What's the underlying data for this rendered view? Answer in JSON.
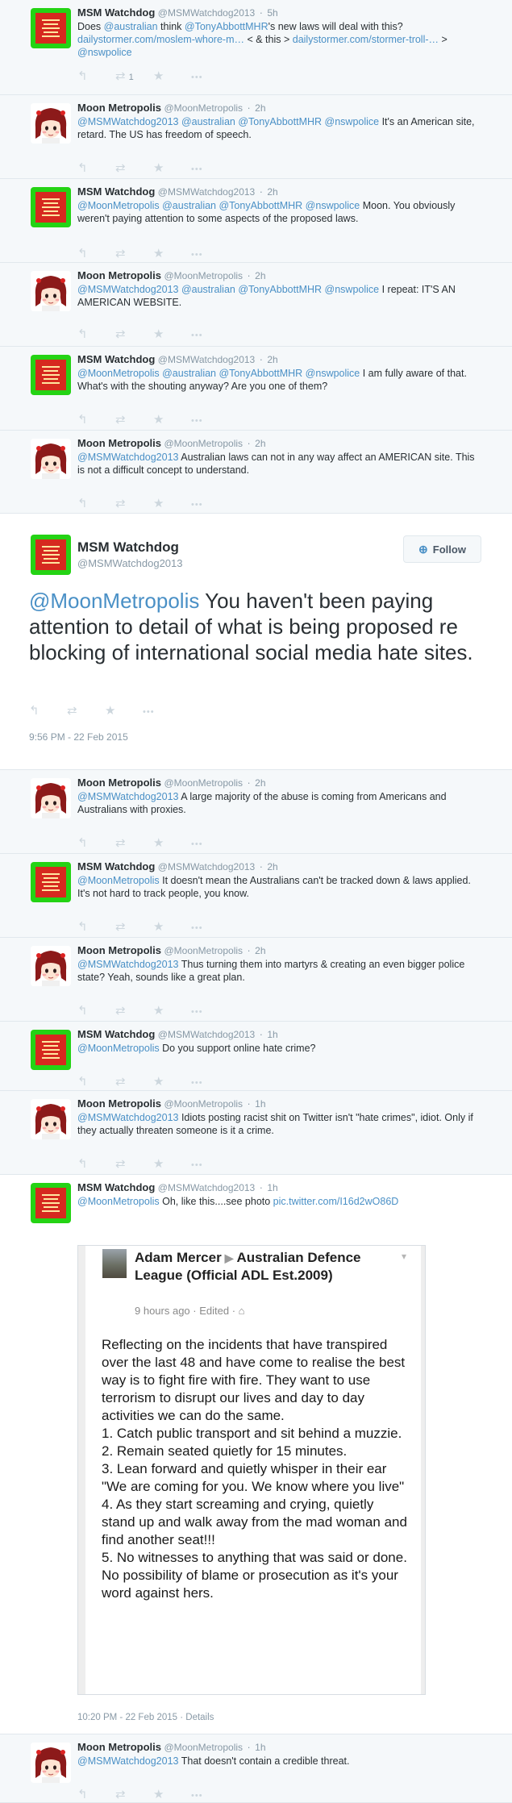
{
  "users": {
    "msm": {
      "name": "MSM Watchdog",
      "handle": "@MSMWatchdog2013"
    },
    "moon": {
      "name": "Moon Metropolis",
      "handle": "@MoonMetropolis"
    }
  },
  "tweets": [
    {
      "name": "MSM Watchdog",
      "handle": "@MSMWatchdog2013",
      "time": "5h",
      "parts": [
        "Does ",
        "@australian",
        " think ",
        "@TonyAbbottMHR",
        "'s new laws will deal with this? ",
        "dailystormer.com/moslem-whore-m…",
        " < & this > ",
        "dailystormer.com/stormer-troll-…",
        " > ",
        "@nswpolice"
      ],
      "retweets": "1"
    },
    {
      "name": "Moon Metropolis",
      "handle": "@MoonMetropolis",
      "time": "2h",
      "parts": [
        "@MSMWatchdog2013",
        " ",
        "@australian",
        " ",
        "@TonyAbbottMHR",
        " ",
        "@nswpolice",
        " It's an American site, retard. The US has freedom of speech."
      ]
    },
    {
      "name": "MSM Watchdog",
      "handle": "@MSMWatchdog2013",
      "time": "2h",
      "parts": [
        "@MoonMetropolis",
        " ",
        "@australian",
        " ",
        "@TonyAbbottMHR",
        " ",
        "@nswpolice",
        " Moon. You obviously weren't paying attention to some aspects of the proposed laws."
      ]
    },
    {
      "name": "Moon Metropolis",
      "handle": "@MoonMetropolis",
      "time": "2h",
      "parts": [
        "@MSMWatchdog2013",
        " ",
        "@australian",
        " ",
        "@TonyAbbottMHR",
        " ",
        "@nswpolice",
        " I repeat: IT'S AN AMERICAN WEBSITE."
      ]
    },
    {
      "name": "MSM Watchdog",
      "handle": "@MSMWatchdog2013",
      "time": "2h",
      "parts": [
        "@MoonMetropolis",
        " ",
        "@australian",
        " ",
        "@TonyAbbottMHR",
        " ",
        "@nswpolice",
        " I am fully aware of that. What's with the shouting anyway? Are you one of them?"
      ]
    },
    {
      "name": "Moon Metropolis",
      "handle": "@MoonMetropolis",
      "time": "2h",
      "parts": [
        "@MSMWatchdog2013",
        " Australian laws can not in any way affect an AMERICAN site. This is not a difficult concept to understand."
      ]
    }
  ],
  "focus": {
    "name": "MSM Watchdog",
    "handle": "@MSMWatchdog2013",
    "follow_label": "Follow",
    "mention": "@MoonMetropolis",
    "text": " You haven't been paying attention to detail of what is being proposed re blocking of international social media hate sites.",
    "date": "9:56 PM - 22 Feb 2015"
  },
  "replies": [
    {
      "name": "Moon Metropolis",
      "handle": "@MoonMetropolis",
      "time": "2h",
      "parts": [
        "@MSMWatchdog2013",
        " A large majority of the abuse is coming from Americans and Australians with proxies."
      ]
    },
    {
      "name": "MSM Watchdog",
      "handle": "@MSMWatchdog2013",
      "time": "2h",
      "parts": [
        "@MoonMetropolis",
        " It doesn't mean the Australians can't be tracked down & laws applied. It's not hard to track people, you know."
      ]
    },
    {
      "name": "Moon Metropolis",
      "handle": "@MoonMetropolis",
      "time": "2h",
      "parts": [
        "@MSMWatchdog2013",
        " Thus turning them into martyrs & creating an even bigger police state? Yeah, sounds like a great plan."
      ]
    },
    {
      "name": "MSM Watchdog",
      "handle": "@MSMWatchdog2013",
      "time": "1h",
      "parts": [
        "@MoonMetropolis",
        " Do you support online hate crime?"
      ]
    },
    {
      "name": "Moon Metropolis",
      "handle": "@MoonMetropolis",
      "time": "1h",
      "parts": [
        "@MSMWatchdog2013",
        " Idiots posting racist shit on Twitter isn't \"hate crimes\", idiot. Only if they actually threaten someone is it a crime."
      ]
    },
    {
      "name": "MSM Watchdog",
      "handle": "@MSMWatchdog2013",
      "time": "1h",
      "parts": [
        "@MoonMetropolis",
        " Oh, like this....see photo ",
        "pic.twitter.com/I16d2wO86D"
      ]
    },
    {
      "name": "Moon Metropolis",
      "handle": "@MoonMetropolis",
      "time": "1h",
      "parts": [
        "@MSMWatchdog2013",
        " That doesn't contain a credible threat."
      ]
    }
  ],
  "photo": {
    "author": "Adam Mercer",
    "arrow": "▶",
    "group": "Australian Defence League (Official ADL Est.2009)",
    "meta": "9 hours ago · Edited ·",
    "paragraphs": [
      "Reflecting on the incidents that have transpired over the last 48 and have come to realise the best way is to fight fire with fire. They want to use terrorism to disrupt our lives and day to day activities we can do the same.",
      "1. Catch public transport and sit behind a muzzie.",
      "2. Remain seated quietly for 15 minutes.",
      "3. Lean forward and quietly whisper in their ear \"We are coming for you. We know where you live\"",
      "4. As they start screaming and crying, quietly stand up and walk away from the mad woman and find another seat!!!",
      "5. No witnesses to anything that was said or done. No possibility of blame or prosecution as it's your word against hers."
    ],
    "date": "10:20 PM - 22 Feb 2015",
    "details": "Details"
  },
  "icons": {
    "reply": "reply-icon",
    "retweet": "retweet-icon",
    "favorite": "star-icon",
    "more": "more-icon",
    "follow": "add-user-icon"
  },
  "colors": {
    "link": "#4a90c6",
    "muted": "#8899a6",
    "msm_avatar_green": "#24d314",
    "msm_avatar_red": "#d6291f"
  }
}
